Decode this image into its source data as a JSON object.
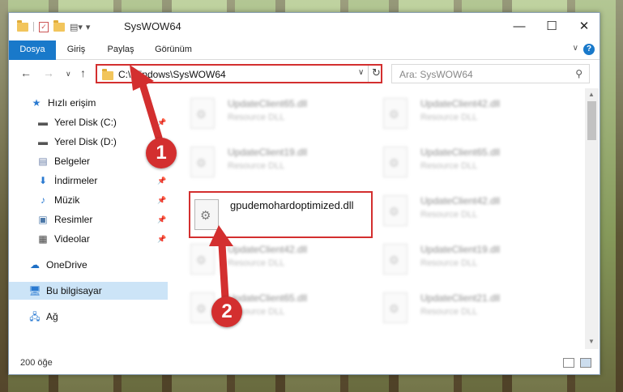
{
  "window": {
    "title": "SysWOW64"
  },
  "ribbon": {
    "tabs": [
      "Dosya",
      "Giriş",
      "Paylaş",
      "Görünüm"
    ]
  },
  "address": {
    "path": "C:\\Windows\\SysWOW64"
  },
  "search": {
    "placeholder": "Ara: SysWOW64"
  },
  "sidebar": {
    "items": [
      {
        "label": "Hızlı erişim",
        "icon": "star-icon"
      },
      {
        "label": "Yerel Disk (C:)",
        "icon": "drive-icon"
      },
      {
        "label": "Yerel Disk (D:)",
        "icon": "drive-icon"
      },
      {
        "label": "Belgeler",
        "icon": "documents-icon"
      },
      {
        "label": "İndirmeler",
        "icon": "download-icon"
      },
      {
        "label": "Müzik",
        "icon": "music-icon"
      },
      {
        "label": "Resimler",
        "icon": "pictures-icon"
      },
      {
        "label": "Videolar",
        "icon": "video-icon"
      },
      {
        "label": "OneDrive",
        "icon": "cloud-icon"
      },
      {
        "label": "Bu bilgisayar",
        "icon": "computer-icon"
      },
      {
        "label": "Ağ",
        "icon": "network-icon"
      }
    ]
  },
  "files": [
    {
      "name": "UpdateClient65.dll",
      "desc": "Resource DLL"
    },
    {
      "name": "UpdateClient42.dll",
      "desc": "Resource DLL"
    },
    {
      "name": "UpdateClient19.dll",
      "desc": "Resource DLL"
    },
    {
      "name": "UpdateClient65.dll",
      "desc": "Resource DLL"
    },
    {
      "name": "UpdateClient42.dll",
      "desc": "Resource DLL"
    },
    {
      "name": "UpdateClient42.dll",
      "desc": "Resource DLL"
    },
    {
      "name": "UpdateClient19.dll",
      "desc": "Resource DLL"
    },
    {
      "name": "UpdateClient65.dll",
      "desc": "Resource DLL"
    },
    {
      "name": "UpdateClient21.dll",
      "desc": "Resource DLL"
    }
  ],
  "highlighted_file": {
    "name": "gpudemohardoptimized.dll"
  },
  "status": {
    "count": "200 öğe"
  },
  "annotations": {
    "step1": "1",
    "step2": "2"
  },
  "colors": {
    "accent": "#1979ca",
    "highlight": "#d32f2f",
    "selected": "#cce4f7"
  }
}
